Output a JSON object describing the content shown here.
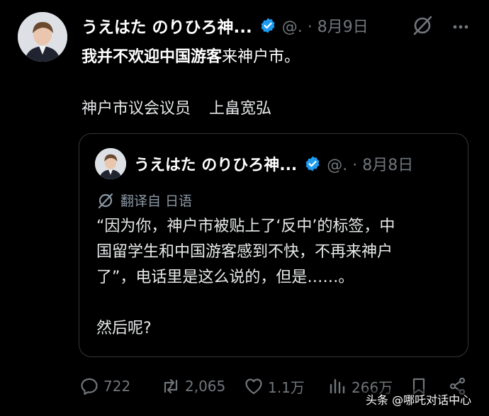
{
  "post": {
    "author_name": "うえはた のりひろ神...",
    "handle_time": "@. · 8月9日",
    "text_bold": "我并不欢迎中国游客",
    "text_rest": "来神户市。",
    "signature_title": "神户市议会议员",
    "signature_name": "上畠宽弘"
  },
  "quote": {
    "author_name": "うえはた のりひろ神...",
    "handle_time": "@. · 8月8日",
    "translated_label": "翻译自 日语",
    "lines": [
      "“因为你，神户市被贴上了‘反中’的标签，中",
      "国留学生和中国游客感到不快，不再来神户",
      "了”，电话里是这么说的，但是……。"
    ],
    "last_line": "然后呢?"
  },
  "actions": {
    "replies": "722",
    "reposts": "2,065",
    "likes": "1.1万",
    "views": "266万"
  },
  "watermark": "头条 @哪吒对话中心",
  "icons": [
    "verified-badge-icon",
    "grok-icon",
    "more-icon",
    "translate-icon",
    "reply-icon",
    "repost-icon",
    "like-icon",
    "views-icon",
    "bookmark-icon",
    "share-icon"
  ],
  "colors": {
    "background": "#000000",
    "text": "#e7e9ea",
    "muted": "#71767b",
    "verified": "#1d9bf0",
    "border": "#333639"
  }
}
